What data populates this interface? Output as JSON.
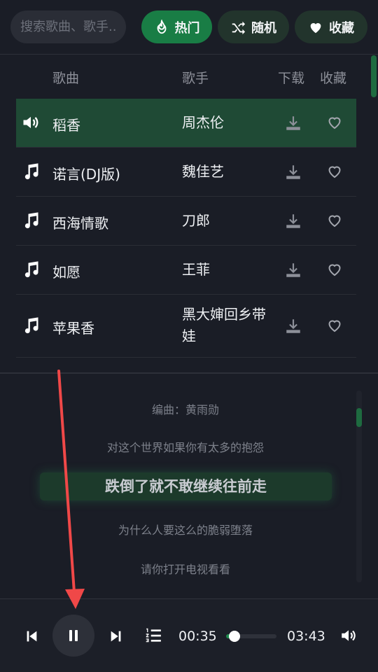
{
  "search": {
    "placeholder": "搜索歌曲、歌手..."
  },
  "filters": [
    {
      "label": "热门",
      "icon": "fire-icon",
      "active": true
    },
    {
      "label": "随机",
      "icon": "shuffle-icon",
      "active": false
    },
    {
      "label": "收藏",
      "icon": "heart-icon",
      "active": false
    }
  ],
  "list": {
    "headers": {
      "song": "歌曲",
      "artist": "歌手",
      "download": "下载",
      "favorite": "收藏"
    },
    "songs": [
      {
        "title": "稻香",
        "artist": "周杰伦",
        "playing": true
      },
      {
        "title": "诺言(DJ版)",
        "artist": "魏佳艺",
        "playing": false
      },
      {
        "title": "西海情歌",
        "artist": "刀郎",
        "playing": false
      },
      {
        "title": "如愿",
        "artist": "王菲",
        "playing": false
      },
      {
        "title": "苹果香",
        "artist": "黑大婶回乡带娃",
        "playing": false
      }
    ]
  },
  "lyrics": {
    "lines": [
      "编曲：黄雨勋",
      "对这个世界如果你有太多的抱怨",
      "跌倒了就不敢继续往前走",
      "为什么人要这么的脆弱堕落",
      "请你打开电视看看"
    ],
    "current_index": 2
  },
  "player": {
    "current_time": "00:35",
    "total_time": "03:43",
    "progress": 0.16,
    "state": "playing"
  },
  "colors": {
    "accent": "#197d45",
    "active_row": "#1f4a35",
    "background": "#1a1d26"
  }
}
